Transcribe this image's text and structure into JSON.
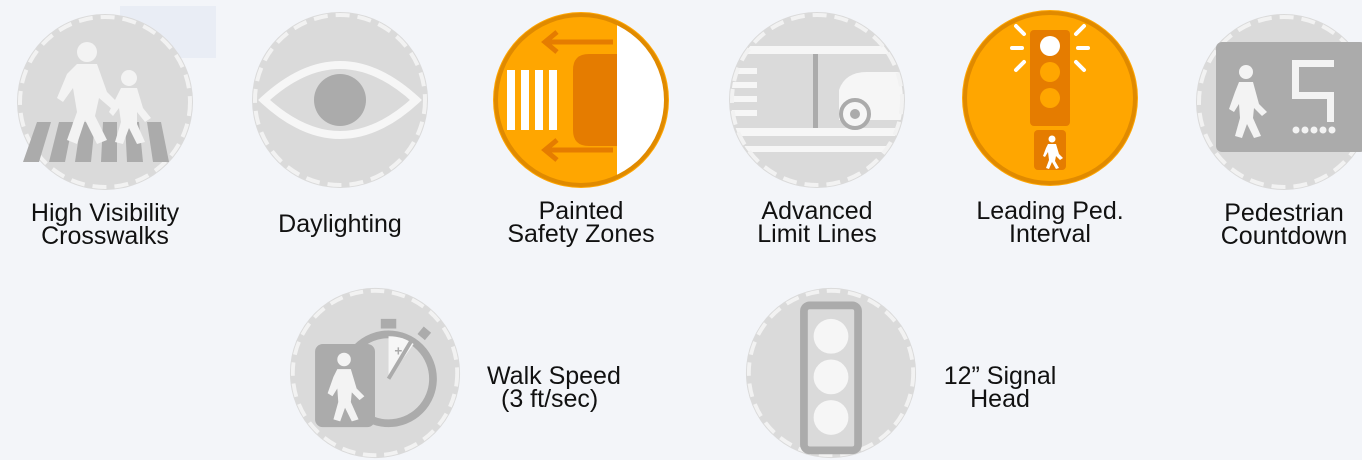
{
  "items": [
    {
      "key": "crosswalks",
      "line1": "High Visibility",
      "line2": "Crosswalks",
      "state": "inactive"
    },
    {
      "key": "daylighting",
      "line1": "Daylighting",
      "line2": "",
      "state": "inactive"
    },
    {
      "key": "safety-zones",
      "line1": "Painted",
      "line2": "Safety Zones",
      "state": "active"
    },
    {
      "key": "limit-lines",
      "line1": "Advanced",
      "line2": "Limit Lines",
      "state": "inactive"
    },
    {
      "key": "leading-ped",
      "line1": "Leading Ped.",
      "line2": "Interval",
      "state": "active"
    },
    {
      "key": "countdown",
      "line1": "Pedestrian",
      "line2": "Countdown",
      "state": "inactive"
    },
    {
      "key": "walk-speed",
      "line1": "Walk Speed",
      "line2": "(3 ft/sec)",
      "state": "inactive"
    },
    {
      "key": "signal-head",
      "line1": "12” Signal",
      "line2": "Head",
      "state": "inactive"
    }
  ],
  "colors": {
    "inactive_fill": "#dadada",
    "inactive_ring": "#f2f2f2",
    "inactive_icon": "#ababab",
    "active_fill": "#ffa600",
    "active_dark": "#e57c00",
    "active_ring": "#fbd27a"
  },
  "icons": [
    "pedestrian-crosswalk-icon",
    "eye-icon",
    "painted-zone-icon",
    "limit-line-icon",
    "traffic-signal-icon",
    "countdown-icon",
    "stopwatch-icon",
    "signal-head-icon"
  ]
}
